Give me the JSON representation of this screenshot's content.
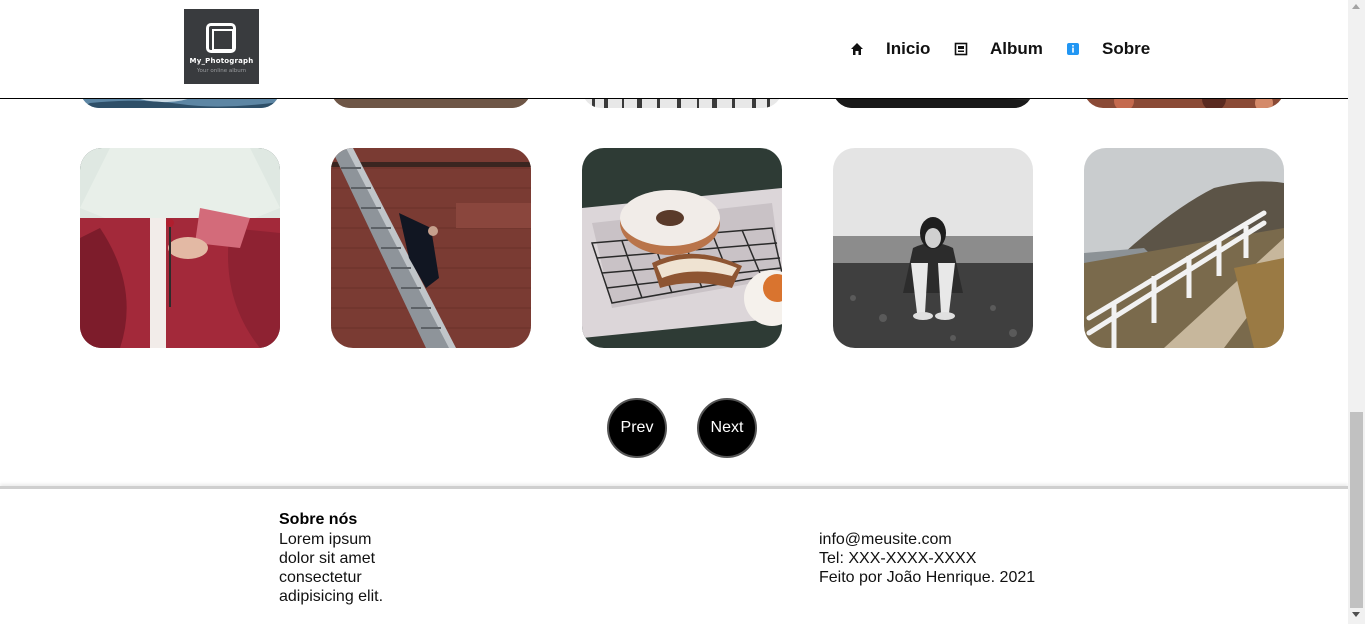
{
  "header": {
    "logo": {
      "title": "My_Photograph",
      "subtitle": "Your online album"
    },
    "nav": [
      {
        "label": "Inicio",
        "icon": "home-icon"
      },
      {
        "label": "Album",
        "icon": "album-icon"
      },
      {
        "label": "Sobre",
        "icon": "info-icon",
        "icon_color": "#2196f3"
      }
    ]
  },
  "gallery": {
    "photos": [
      {
        "subject": "woman in red hanbok"
      },
      {
        "subject": "person on metal stairs by red brick wall"
      },
      {
        "subject": "bundt cake on cooling rack"
      },
      {
        "subject": "woman sitting on beach, black and white"
      },
      {
        "subject": "coastal path with white fence"
      }
    ]
  },
  "pagination": {
    "prev_label": "Prev",
    "next_label": "Next"
  },
  "footer": {
    "about_title": "Sobre nós",
    "about_text": "Lorem ipsum dolor sit amet consectetur adipisicing elit.",
    "email": "info@meusite.com",
    "phone": "Tel: XXX-XXXX-XXXX",
    "credit": "Feito por João Henrique. 2021"
  },
  "colors": {
    "accent": "#000000",
    "info_icon": "#2196f3"
  }
}
